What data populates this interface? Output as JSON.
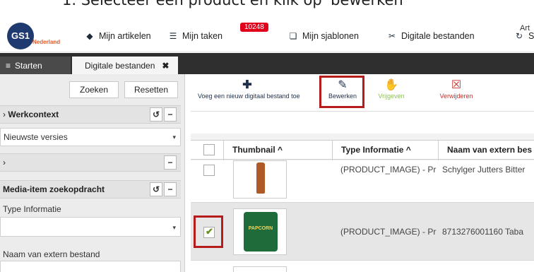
{
  "instruction": "1.  Selecteer een product en klik op 'bewerken'",
  "logo": {
    "text": "GS1",
    "sub": "Nederland"
  },
  "nav": {
    "items": [
      {
        "label": "Mijn artikelen",
        "icon": "cube-icon"
      },
      {
        "label": "Mijn taken",
        "icon": "tasks-icon",
        "badge": "10248"
      },
      {
        "label": "Mijn sjablonen",
        "icon": "copy-icon"
      },
      {
        "label": "Digitale bestanden",
        "icon": "paperclip-icon"
      },
      {
        "label": "S",
        "icon": "refresh-icon"
      }
    ],
    "right_text": "Art"
  },
  "tabs": {
    "start": "Starten",
    "files": "Digitale bestanden"
  },
  "left": {
    "search_btn": "Zoeken",
    "reset_btn": "Resetten",
    "section1": "Werkcontext",
    "version_value": "Nieuwste versies",
    "section3": "Media-item zoekopdracht",
    "type_label": "Type Informatie",
    "name_label": "Naam van extern bestand"
  },
  "toolbar": {
    "add": "Voeg een nieuw digitaal bestand toe",
    "edit": "Bewerken",
    "share": "Vrijgeven",
    "delete": "Verwijderen"
  },
  "grid": {
    "headers": [
      "Thumbnail ^",
      "Type Informatie ^",
      "Naam van extern bes"
    ],
    "rows": [
      {
        "type": "(PRODUCT_IMAGE) - Pr",
        "name": "Schylger Jutters Bitter",
        "checked": false
      },
      {
        "type": "(PRODUCT_IMAGE) - Pr",
        "name": "8713276001160 Taba",
        "checked": true,
        "thumb_label": "PAPCORN"
      }
    ]
  },
  "colors": {
    "accent_red": "#b71c1c",
    "tabbar": "#2f2f2f",
    "badge": "#e3001b"
  }
}
